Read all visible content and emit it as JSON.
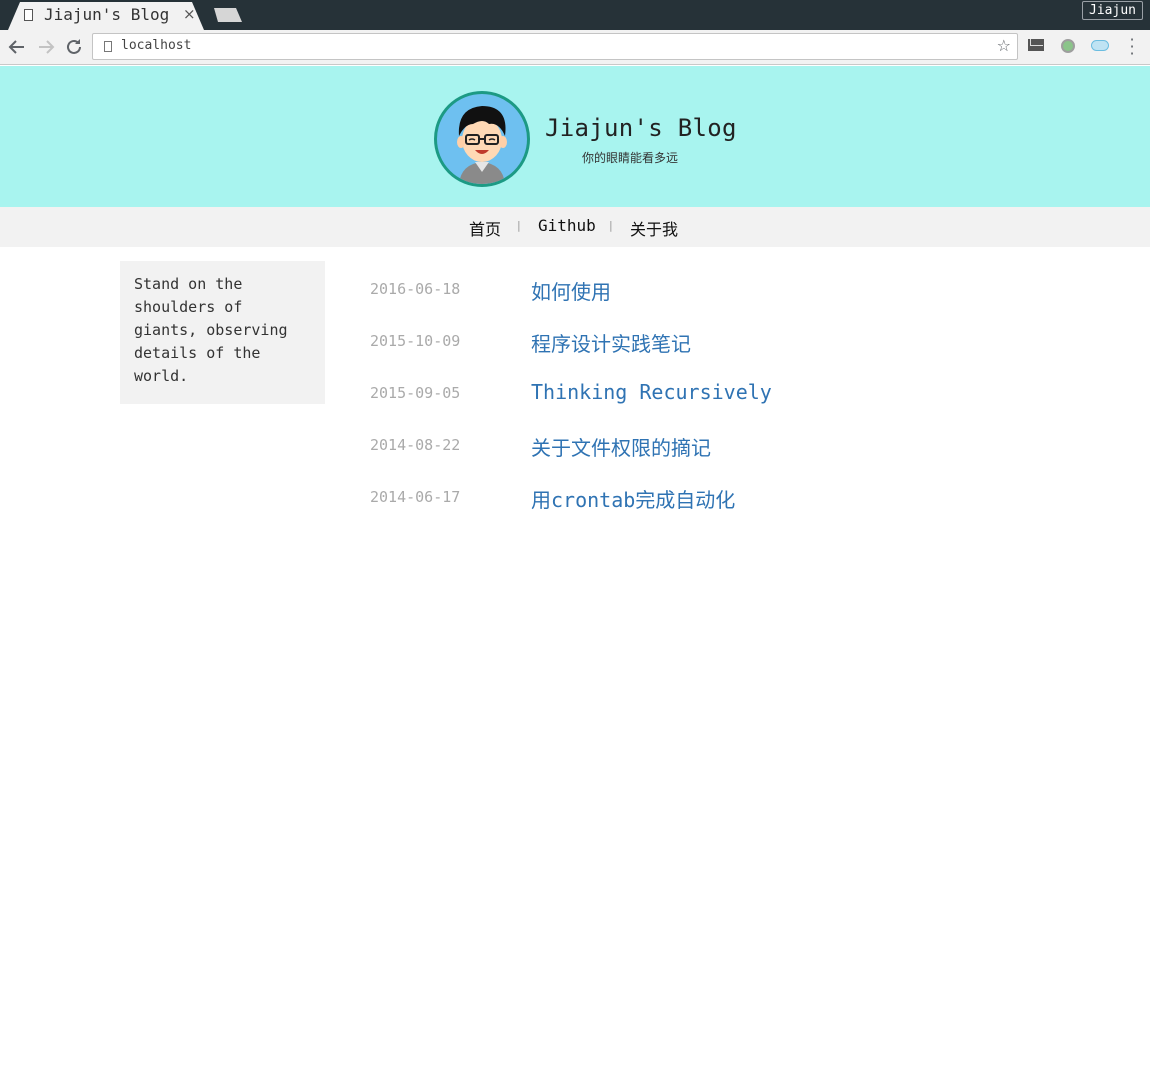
{
  "browser": {
    "tab_title": "Jiajun's Blog",
    "tab_close": "×",
    "profile": "Jiajun",
    "url": "localhost",
    "icons": {
      "back": "back-arrow-icon",
      "forward": "forward-arrow-icon",
      "reload": "reload-icon",
      "bookmark": "star-icon",
      "mail": "mail-icon",
      "ext": "extension-icon",
      "cloud": "cloud-icon",
      "menu": "more-vert-icon"
    }
  },
  "header": {
    "title": "Jiajun's Blog",
    "subtitle": "你的眼睛能看多远",
    "bg_color": "#a8f4ef"
  },
  "nav": {
    "items": [
      "首页",
      "Github",
      "关于我"
    ],
    "separator": "|"
  },
  "sidebar": {
    "text": "Stand on the shoulders of giants, observing details of the world."
  },
  "posts": [
    {
      "date": "2016-06-18",
      "title": "如何使用"
    },
    {
      "date": "2015-10-09",
      "title": "程序设计实践笔记"
    },
    {
      "date": "2015-09-05",
      "title": "Thinking Recursively"
    },
    {
      "date": "2014-08-22",
      "title": "关于文件权限的摘记"
    },
    {
      "date": "2014-06-17",
      "title": "用crontab完成自动化"
    }
  ],
  "colors": {
    "link": "#2f73b3",
    "date": "#aaaaaa",
    "nav_bg": "#f2f2f2"
  }
}
